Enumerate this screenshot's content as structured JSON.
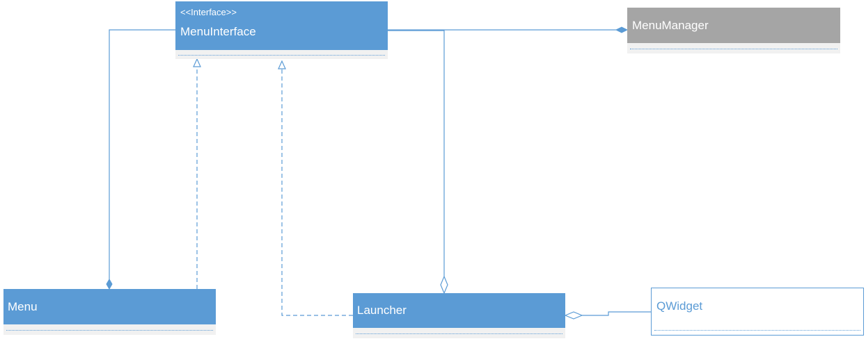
{
  "diagram": {
    "classes": {
      "menu_interface": {
        "stereotype": "<<Interface>>",
        "name": "MenuInterface"
      },
      "menu_manager": {
        "name": "MenuManager"
      },
      "menu": {
        "name": "Menu"
      },
      "launcher": {
        "name": "Launcher"
      },
      "qwidget": {
        "name": "QWidget"
      }
    },
    "relations": [
      {
        "from": "Menu",
        "to": "MenuInterface",
        "type": "composition"
      },
      {
        "from": "Menu",
        "to": "MenuInterface",
        "type": "realization"
      },
      {
        "from": "Launcher",
        "to": "MenuInterface",
        "type": "realization"
      },
      {
        "from": "Launcher",
        "to": "MenuInterface",
        "type": "aggregation"
      },
      {
        "from": "MenuManager",
        "to": "MenuInterface",
        "type": "composition"
      },
      {
        "from": "Launcher",
        "to": "QWidget",
        "type": "aggregation"
      }
    ],
    "colors": {
      "class_fill": "#5b9bd5",
      "external_fill": "#a5a5a5",
      "line": "#5b9bd5",
      "compartment": "#f1f1f1"
    }
  }
}
